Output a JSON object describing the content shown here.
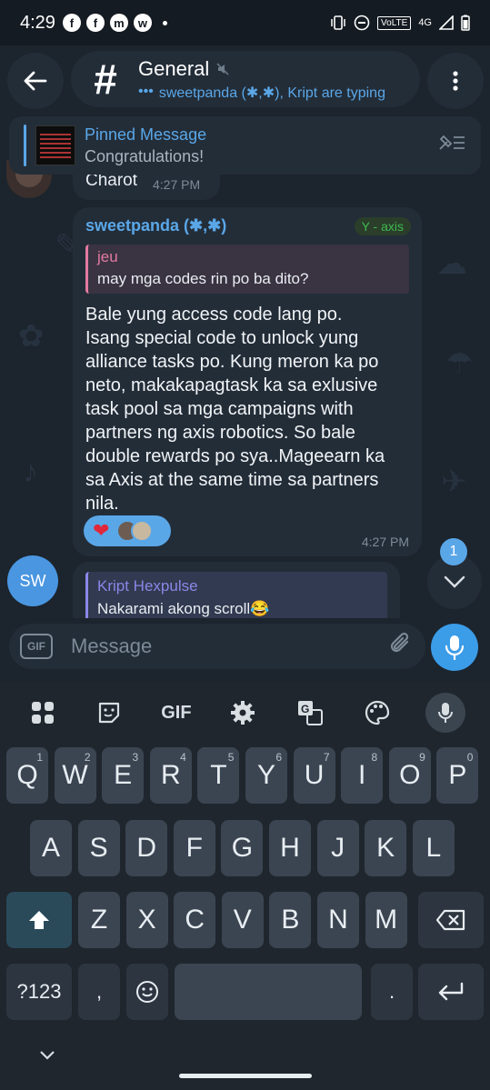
{
  "status_bar": {
    "time": "4:29",
    "apps": [
      "f",
      "f",
      "m",
      "w"
    ],
    "network_label": "VoLTE",
    "network_type": "4G"
  },
  "header": {
    "title": "General",
    "hash": "#",
    "typing": "sweetpanda (✱,✱), Kript are typing",
    "typing_dots": "•••"
  },
  "pinned": {
    "title": "Pinned Message",
    "text": "Congratulations!"
  },
  "messages": {
    "top": {
      "text": "Charot",
      "time": "4:27 PM"
    },
    "main": {
      "sender": "sweetpanda (✱,✱)",
      "tag": "Y - axis",
      "reply_name": "jeu",
      "reply_text": "may mga codes rin po ba dito?",
      "body": "Bale yung access code lang po.\nIsang special code to unlock yung\nalliance tasks po. Kung meron ka po\nneto, makakapagtask ka sa exlusive\ntask pool sa mga campaigns with\npartners ng axis robotics. So bale\ndouble rewards po sya..Mageearn ka\nsa Axis at the same time sa partners\nnila.",
      "reaction": "❤",
      "time": "4:27 PM"
    },
    "second": {
      "avatar_initials": "SW",
      "reply_name": "Kript Hexpulse",
      "reply_text": "Nakarami akong scroll😂"
    }
  },
  "scroll_down": {
    "unread": "1"
  },
  "composer": {
    "gif_label": "GIF",
    "placeholder": "Message"
  },
  "keyboard": {
    "toolbar_gif": "GIF",
    "row1": [
      {
        "k": "Q",
        "n": "1"
      },
      {
        "k": "W",
        "n": "2"
      },
      {
        "k": "E",
        "n": "3"
      },
      {
        "k": "R",
        "n": "4"
      },
      {
        "k": "T",
        "n": "5"
      },
      {
        "k": "Y",
        "n": "6"
      },
      {
        "k": "U",
        "n": "7"
      },
      {
        "k": "I",
        "n": "8"
      },
      {
        "k": "O",
        "n": "9"
      },
      {
        "k": "P",
        "n": "0"
      }
    ],
    "row2": [
      "A",
      "S",
      "D",
      "F",
      "G",
      "H",
      "J",
      "K",
      "L"
    ],
    "row3": [
      "Z",
      "X",
      "C",
      "V",
      "B",
      "N",
      "M"
    ],
    "symbols_label": "?123",
    "comma": ",",
    "period": "."
  }
}
